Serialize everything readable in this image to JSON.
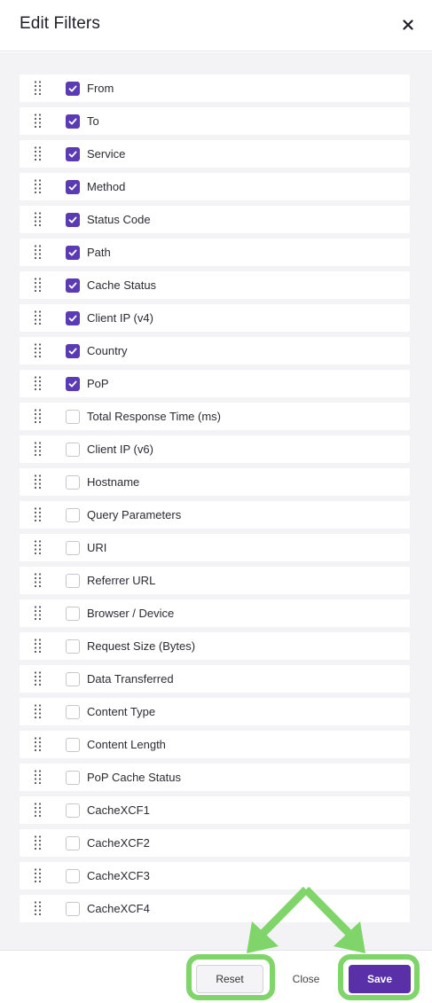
{
  "header": {
    "title": "Edit Filters",
    "close_icon": "close-icon"
  },
  "colors": {
    "accent": "#5a3bb3",
    "save_bg": "#5a30a8",
    "highlight": "#7fd46a"
  },
  "filters": [
    {
      "label": "From",
      "checked": true
    },
    {
      "label": "To",
      "checked": true
    },
    {
      "label": "Service",
      "checked": true
    },
    {
      "label": "Method",
      "checked": true
    },
    {
      "label": "Status Code",
      "checked": true
    },
    {
      "label": "Path",
      "checked": true
    },
    {
      "label": "Cache Status",
      "checked": true
    },
    {
      "label": "Client IP (v4)",
      "checked": true
    },
    {
      "label": "Country",
      "checked": true
    },
    {
      "label": "PoP",
      "checked": true
    },
    {
      "label": "Total Response Time (ms)",
      "checked": false
    },
    {
      "label": "Client IP (v6)",
      "checked": false
    },
    {
      "label": "Hostname",
      "checked": false
    },
    {
      "label": "Query Parameters",
      "checked": false
    },
    {
      "label": "URI",
      "checked": false
    },
    {
      "label": "Referrer URL",
      "checked": false
    },
    {
      "label": "Browser / Device",
      "checked": false
    },
    {
      "label": "Request Size (Bytes)",
      "checked": false
    },
    {
      "label": "Data Transferred",
      "checked": false
    },
    {
      "label": "Content Type",
      "checked": false
    },
    {
      "label": "Content Length",
      "checked": false
    },
    {
      "label": "PoP Cache Status",
      "checked": false
    },
    {
      "label": "CacheXCF1",
      "checked": false
    },
    {
      "label": "CacheXCF2",
      "checked": false
    },
    {
      "label": "CacheXCF3",
      "checked": false
    },
    {
      "label": "CacheXCF4",
      "checked": false
    }
  ],
  "footer": {
    "reset_label": "Reset",
    "close_label": "Close",
    "save_label": "Save"
  }
}
